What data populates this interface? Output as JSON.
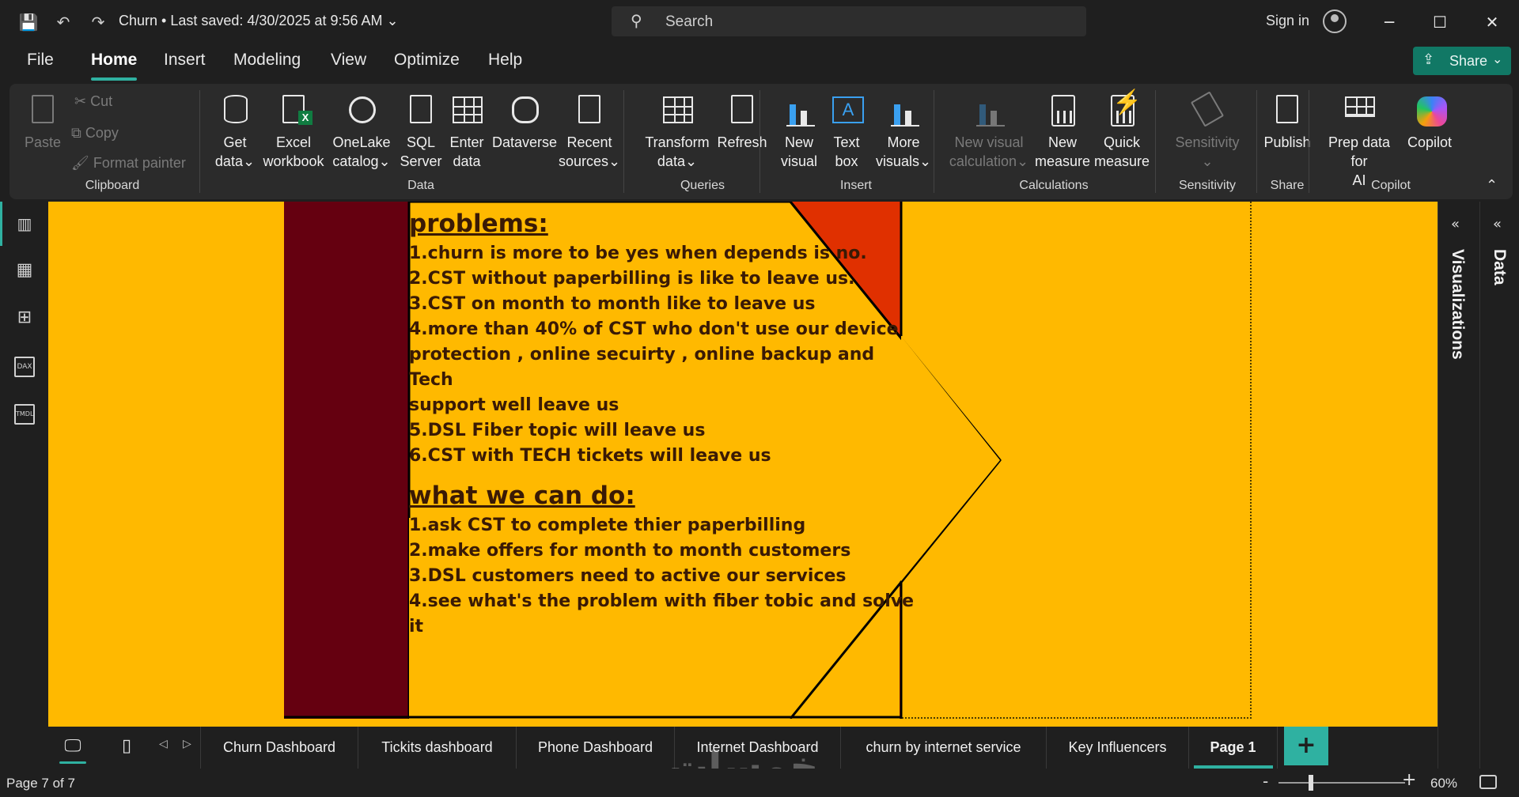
{
  "titlebar": {
    "doc_title": "Churn • Last saved: 4/30/2025 at 9:56 AM",
    "search_placeholder": "Search",
    "sign_in": "Sign in"
  },
  "menu": {
    "items": [
      "File",
      "Home",
      "Insert",
      "Modeling",
      "View",
      "Optimize",
      "Help"
    ],
    "active": "Home",
    "share": "Share"
  },
  "ribbon": {
    "clipboard": {
      "paste": "Paste",
      "cut": "Cut",
      "copy": "Copy",
      "format_painter": "Format painter",
      "label": "Clipboard"
    },
    "data": {
      "get_data": [
        "Get",
        "data"
      ],
      "excel": [
        "Excel",
        "workbook"
      ],
      "onelake": [
        "OneLake",
        "catalog"
      ],
      "sql": [
        "SQL",
        "Server"
      ],
      "enter": [
        "Enter",
        "data"
      ],
      "dataverse": "Dataverse",
      "recent": [
        "Recent",
        "sources"
      ],
      "label": "Data"
    },
    "queries": {
      "transform": [
        "Transform",
        "data"
      ],
      "refresh": "Refresh",
      "label": "Queries"
    },
    "insert": {
      "new_visual": [
        "New",
        "visual"
      ],
      "text_box": [
        "Text",
        "box"
      ],
      "more_visuals": [
        "More",
        "visuals"
      ],
      "label": "Insert"
    },
    "calculations": {
      "new_visual_calc": [
        "New visual",
        "calculation"
      ],
      "new_measure": [
        "New",
        "measure"
      ],
      "quick_measure": [
        "Quick",
        "measure"
      ],
      "label": "Calculations"
    },
    "sensitivity": {
      "btn": "Sensitivity",
      "label": "Sensitivity"
    },
    "share": {
      "publish": "Publish",
      "label": "Share"
    },
    "copilot": {
      "prep": [
        "Prep data for",
        "AI"
      ],
      "copilot": "Copilot",
      "label": "Copilot"
    }
  },
  "canvas": {
    "heading1": "problems:",
    "problems": [
      "1.churn is more to be yes when depends is no.",
      "2.CST without paperbilling is like to leave us.",
      "3.CST on month to month like to leave us",
      "4.more than 40% of CST who don't use our device",
      "protection , online secuirty , online backup and Tech",
      "support well leave us",
      "5.DSL Fiber topic will leave us",
      "6.CST with TECH tickets will leave us"
    ],
    "heading2": "what we can do:",
    "actions": [
      "1.ask CST to complete thier paperbilling",
      "2.make offers for month to month customers",
      "3.DSL customers need to active our services",
      "4.see what's the problem with fiber tobic and solve it"
    ],
    "colors": {
      "background": "#ffb900",
      "maroon": "#650010",
      "orange_red": "#e03000",
      "text": "#3a1a05"
    }
  },
  "panes": {
    "visualizations": "Visualizations",
    "data": "Data"
  },
  "tabs": {
    "pages": [
      "Churn Dashboard",
      "Tickits dashboard",
      "Phone Dashboard",
      "Internet Dashboard",
      "churn by internet service",
      "Key Influencers",
      "Page 1"
    ],
    "active": "Page 1"
  },
  "status": {
    "page": "Page 7 of 7",
    "zoom": "60%"
  },
  "watermark": "خمسات"
}
